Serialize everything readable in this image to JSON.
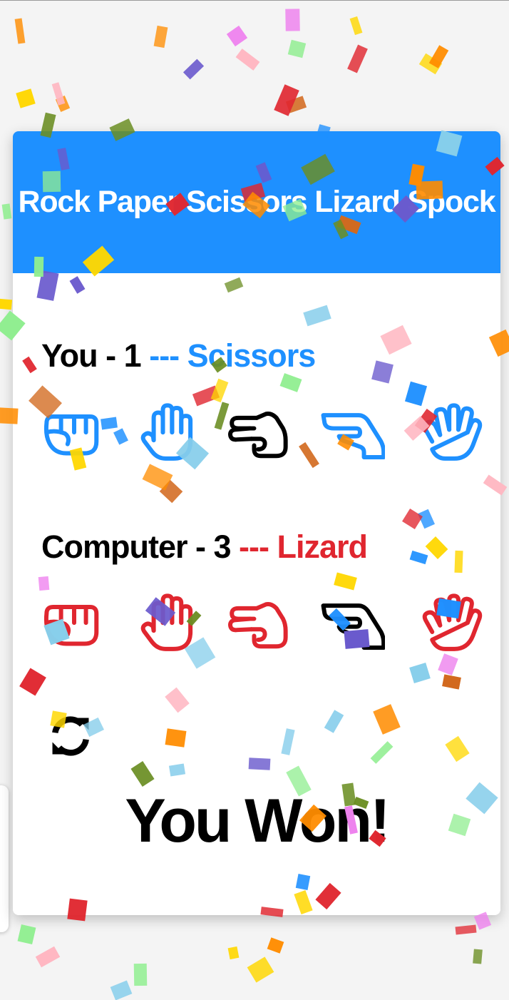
{
  "app": {
    "title": "Rock Paper Scissors Lizard Spock"
  },
  "player": {
    "name": "You",
    "score": "1",
    "separator": "---",
    "choice": "Scissors"
  },
  "computer": {
    "name": "Computer",
    "score": "3",
    "separator": "---",
    "choice": "Lizard"
  },
  "result": "You Won!",
  "options": [
    "Rock",
    "Paper",
    "Scissors",
    "Lizard",
    "Spock"
  ],
  "colors": {
    "header": "#1e90ff",
    "player": "#1e90ff",
    "computer": "#e0262f",
    "selected": "#000000"
  },
  "icons": {
    "rock": "hand-fist-icon",
    "paper": "hand-paper-icon",
    "scissors": "hand-scissors-icon",
    "lizard": "hand-lizard-icon",
    "spock": "hand-spock-icon",
    "reset": "sync-icon"
  }
}
